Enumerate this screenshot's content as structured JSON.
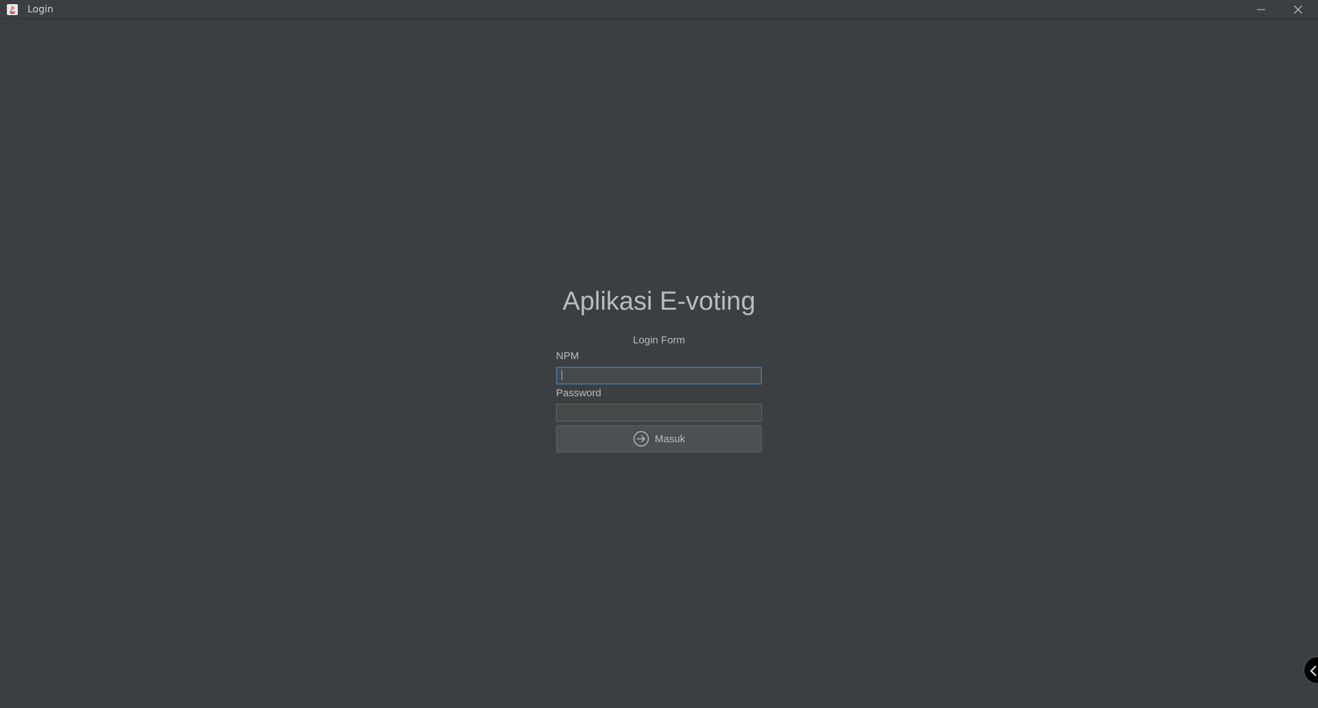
{
  "window": {
    "title": "Login",
    "app_icon": "java-icon",
    "controls": [
      "minimize-icon",
      "close-icon"
    ]
  },
  "main": {
    "app_title": "Aplikasi E-voting",
    "form_title": "Login Form",
    "npm": {
      "label": "NPM",
      "value": "",
      "placeholder": ""
    },
    "password": {
      "label": "Password",
      "value": "",
      "placeholder": ""
    },
    "submit": {
      "label": "Masuk",
      "icon": "sign-in-icon"
    }
  },
  "overlay": {
    "handle_icon": "chevron-left-icon"
  },
  "colors": {
    "background": "#3c3f41",
    "text": "#bbbbbb",
    "focus_border": "#466d94",
    "field_background": "#45494a",
    "button_background": "#4c5052"
  }
}
